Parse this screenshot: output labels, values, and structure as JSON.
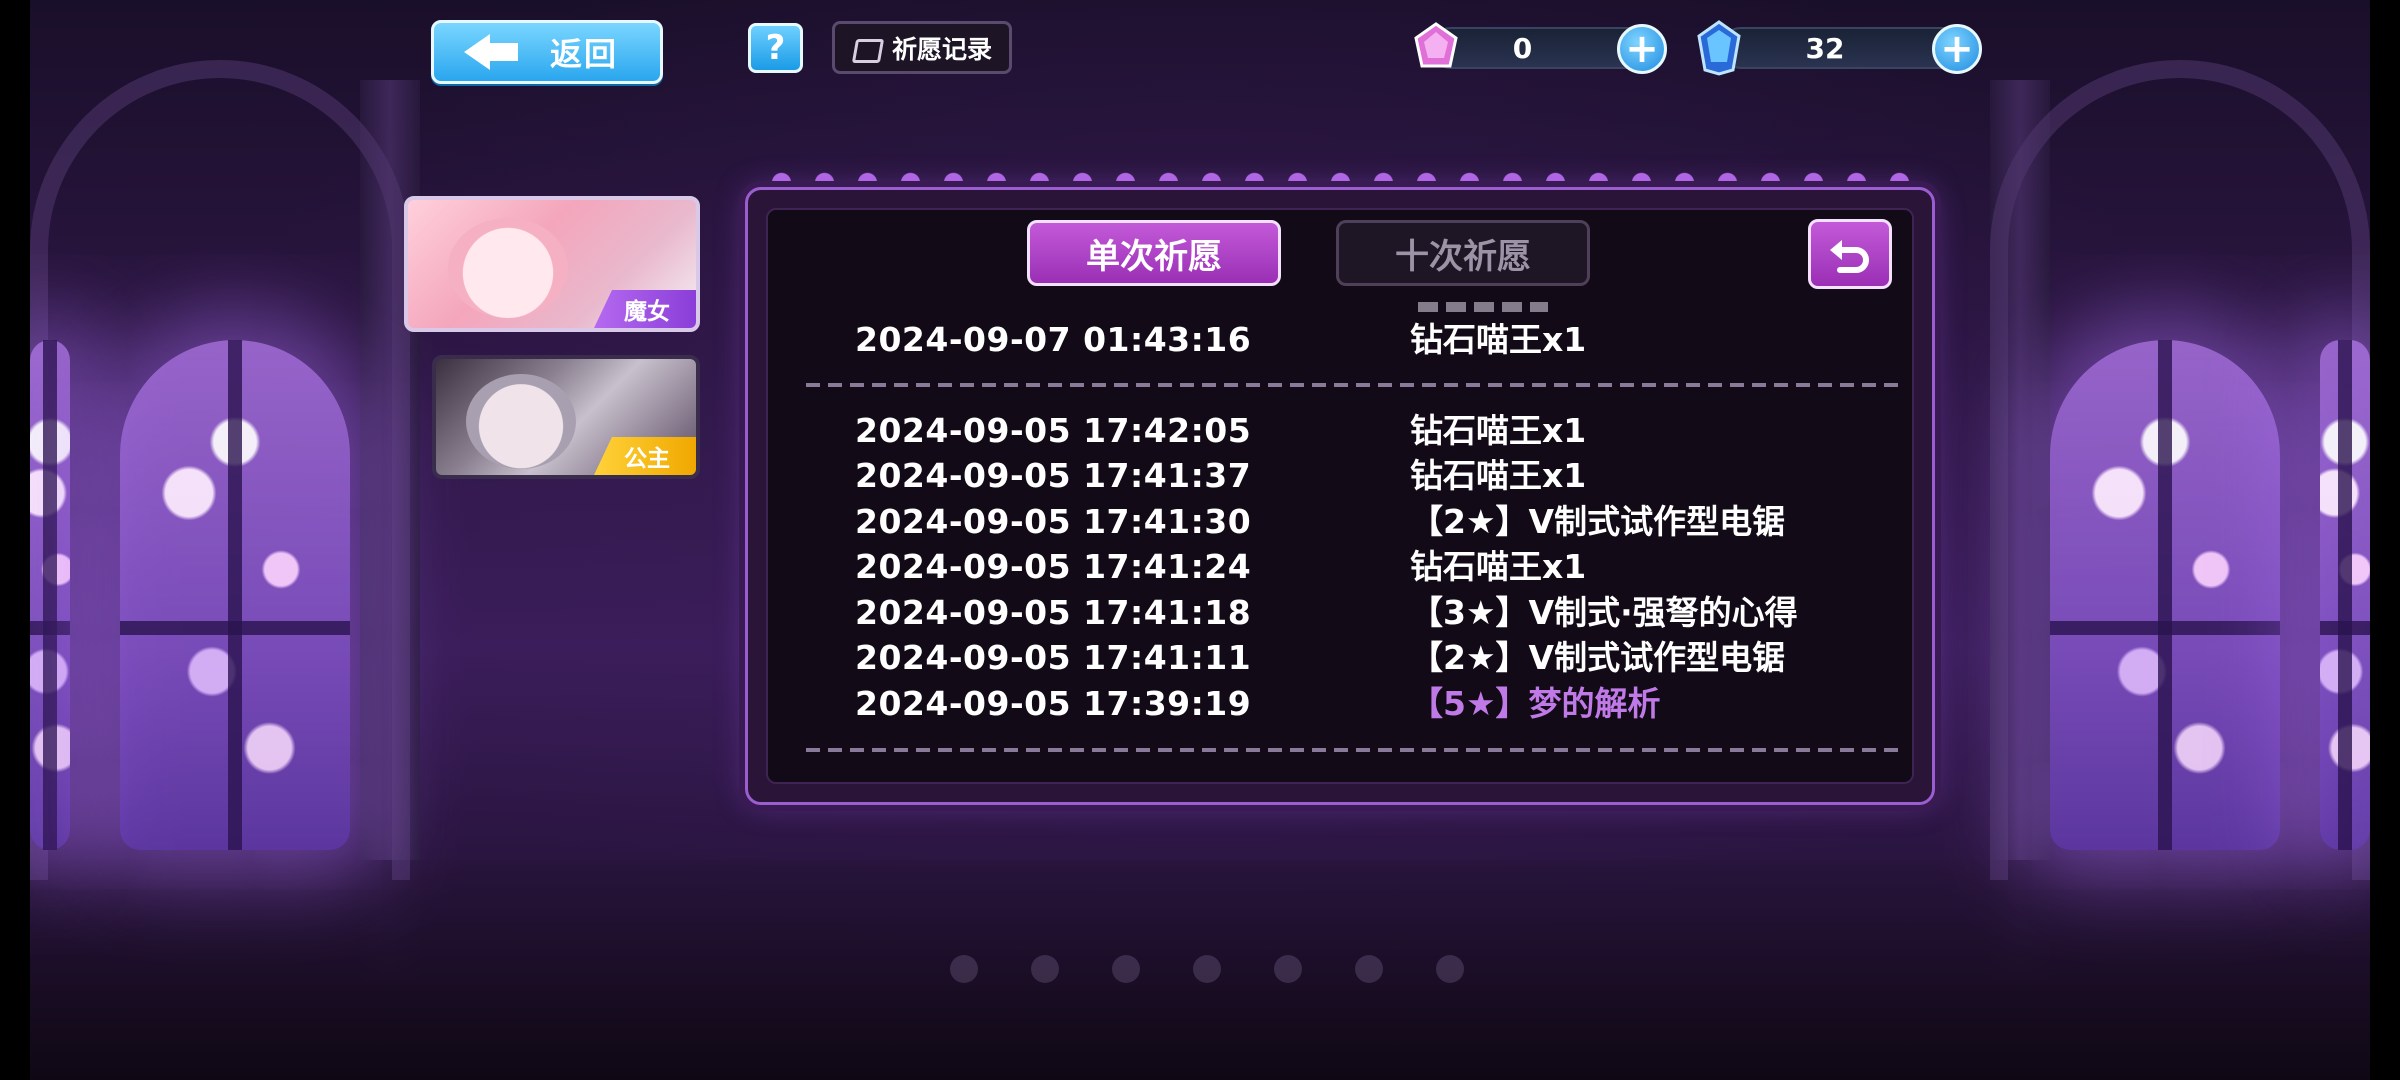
{
  "topbar": {
    "back_label": "返回",
    "help_label": "?",
    "record_label": "祈愿记录"
  },
  "currencies": [
    {
      "icon": "pink-gem-icon",
      "value": "0"
    },
    {
      "icon": "blue-crystal-icon",
      "value": "32"
    }
  ],
  "characters": [
    {
      "tag": "魔女",
      "tag_color": "#9a4de0"
    },
    {
      "tag": "公主",
      "tag_color": "#f5b800"
    }
  ],
  "panel": {
    "tabs": [
      {
        "label": "单次祈愿",
        "active": true
      },
      {
        "label": "十次祈愿",
        "active": false
      }
    ],
    "records": [
      {
        "time": "2024-09-07 01:43:16",
        "item": "钻石喵王x1",
        "rare": false
      },
      {
        "time": "2024-09-05 17:42:05",
        "item": "钻石喵王x1",
        "rare": false
      },
      {
        "time": "2024-09-05 17:41:37",
        "item": "钻石喵王x1",
        "rare": false
      },
      {
        "time": "2024-09-05 17:41:30",
        "item": "【2★】V制式试作型电锯",
        "rare": false
      },
      {
        "time": "2024-09-05 17:41:24",
        "item": "钻石喵王x1",
        "rare": false
      },
      {
        "time": "2024-09-05 17:41:18",
        "item": "【3★】V制式·强弩的心得",
        "rare": false
      },
      {
        "time": "2024-09-05 17:41:11",
        "item": "【2★】V制式试作型电锯",
        "rare": false
      },
      {
        "time": "2024-09-05 17:39:19",
        "item": "【5★】梦的解析",
        "rare": true
      }
    ]
  },
  "colors": {
    "accent_purple": "#b04ad0",
    "button_blue": "#2aa6ee",
    "rare_text": "#c07ae8"
  }
}
